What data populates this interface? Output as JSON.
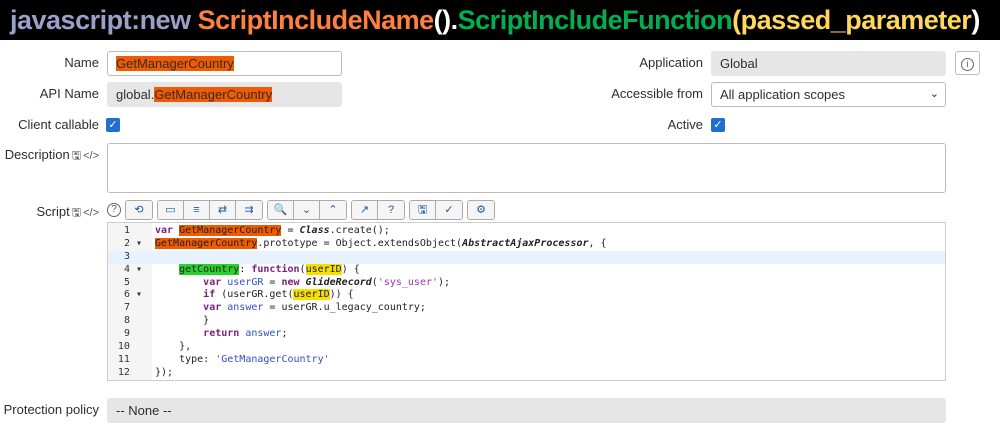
{
  "banner": {
    "prefix": "javascript:new ",
    "name": "ScriptIncludeName",
    "paren1": "()",
    "dot": ".",
    "func": "ScriptIncludeFunction",
    "open": "(",
    "param": "passed_parameter",
    "close": ")",
    "colors": {
      "prefix": "#9aa0c8",
      "name": "#ff7f3f",
      "paren": "#ffffff",
      "func": "#00b050",
      "param": "#ffd75a"
    }
  },
  "form": {
    "name_label": "Name",
    "name_value": "GetManagerCountry",
    "api_label": "API Name",
    "api_prefix": "global.",
    "api_value": "GetManagerCountry",
    "client_label": "Client callable",
    "client_checked": true,
    "desc_label": "Description",
    "desc_value": "",
    "script_label": "Script",
    "application_label": "Application",
    "application_value": "Global",
    "access_label": "Accessible from",
    "access_value": "All application scopes",
    "active_label": "Active",
    "active_checked": true,
    "protection_label": "Protection policy",
    "protection_value": "-- None --"
  },
  "code_lines": [
    {
      "n": "1",
      "fold": "",
      "tokens": [
        [
          "var ",
          "kw"
        ],
        [
          "GetManagerCountry",
          "hl-o"
        ],
        [
          " = ",
          ""
        ],
        [
          "Class",
          "it"
        ],
        [
          ".create();",
          ""
        ]
      ]
    },
    {
      "n": "2",
      "fold": "▾",
      "tokens": [
        [
          "GetManagerCountry",
          "hl-o"
        ],
        [
          ".prototype = Object.extendsObject(",
          ""
        ],
        [
          "AbstractAjaxProcessor",
          "it"
        ],
        [
          ", {",
          ""
        ]
      ]
    },
    {
      "n": "3",
      "fold": "",
      "tokens": []
    },
    {
      "n": "4",
      "fold": "▾",
      "tokens": [
        [
          "    ",
          ""
        ],
        [
          "getCountry",
          "hl-g"
        ],
        [
          ": ",
          ""
        ],
        [
          "function",
          "kw"
        ],
        [
          "(",
          ""
        ],
        [
          "userID",
          "hl-y"
        ],
        [
          ") {",
          ""
        ]
      ]
    },
    {
      "n": "5",
      "fold": "",
      "tokens": [
        [
          "        ",
          ""
        ],
        [
          "var ",
          "kw"
        ],
        [
          "userGR",
          "var"
        ],
        [
          " = ",
          ""
        ],
        [
          "new ",
          "kw"
        ],
        [
          "GlideRecord",
          "it"
        ],
        [
          "(",
          ""
        ],
        [
          "'sys_user'",
          "str"
        ],
        [
          ");",
          ""
        ]
      ]
    },
    {
      "n": "6",
      "fold": "▾",
      "tokens": [
        [
          "        ",
          ""
        ],
        [
          "if ",
          "kw"
        ],
        [
          "(userGR.get(",
          ""
        ],
        [
          "userID",
          "hl-y"
        ],
        [
          ")) {",
          ""
        ]
      ]
    },
    {
      "n": "7",
      "fold": "",
      "tokens": [
        [
          "        ",
          ""
        ],
        [
          "var ",
          "kw"
        ],
        [
          "answer",
          "var"
        ],
        [
          " = userGR.u_legacy_country;",
          ""
        ]
      ]
    },
    {
      "n": "8",
      "fold": "",
      "tokens": [
        [
          "        }",
          ""
        ]
      ]
    },
    {
      "n": "9",
      "fold": "",
      "tokens": [
        [
          "        ",
          ""
        ],
        [
          "return ",
          "kw"
        ],
        [
          "answer",
          "var"
        ],
        [
          ";",
          ""
        ]
      ]
    },
    {
      "n": "10",
      "fold": "",
      "tokens": [
        [
          "    },",
          ""
        ]
      ]
    },
    {
      "n": "11",
      "fold": "",
      "tokens": [
        [
          "    type: ",
          ""
        ],
        [
          "'GetManagerCountry'",
          "str2"
        ]
      ]
    },
    {
      "n": "12",
      "fold": "",
      "tokens": [
        [
          "});",
          ""
        ]
      ]
    }
  ]
}
